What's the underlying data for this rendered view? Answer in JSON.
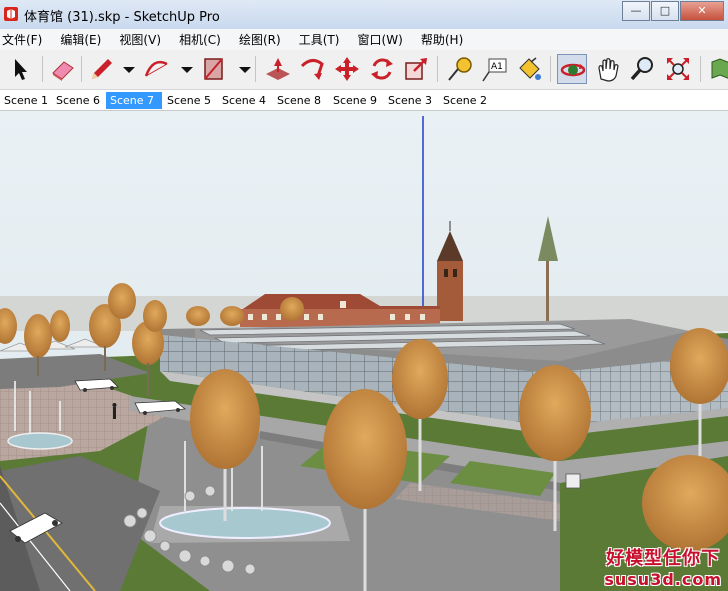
{
  "window": {
    "title": "体育馆 (31).skp - SketchUp Pro",
    "minimize": "—",
    "maximize": "□",
    "close": "✕"
  },
  "menu": [
    "文件(F)",
    "编辑(E)",
    "视图(V)",
    "相机(C)",
    "绘图(R)",
    "工具(T)",
    "窗口(W)",
    "帮助(H)"
  ],
  "toolbar": {
    "tools": [
      "select",
      "eraser",
      "pencil",
      "arc",
      "rectangle",
      "push-pull",
      "follow-me",
      "move",
      "rotate",
      "scale",
      "tape-measure",
      "text",
      "paint-bucket",
      "orbit",
      "pan",
      "zoom",
      "zoom-extents",
      "map"
    ],
    "text_tool_label": "A1"
  },
  "scenes": {
    "tabs": [
      "Scene 1",
      "Scene 6",
      "Scene 7",
      "Scene 5",
      "Scene 4",
      "Scene 8",
      "Scene 9",
      "Scene 3",
      "Scene 2"
    ],
    "active": "Scene 7"
  },
  "watermark": {
    "line1": "好模型任你下",
    "line2": "susu3d.com"
  },
  "colors": {
    "scene_active": "#3399ff",
    "sky": "#e6eef3",
    "ground": "#5a7a36"
  }
}
